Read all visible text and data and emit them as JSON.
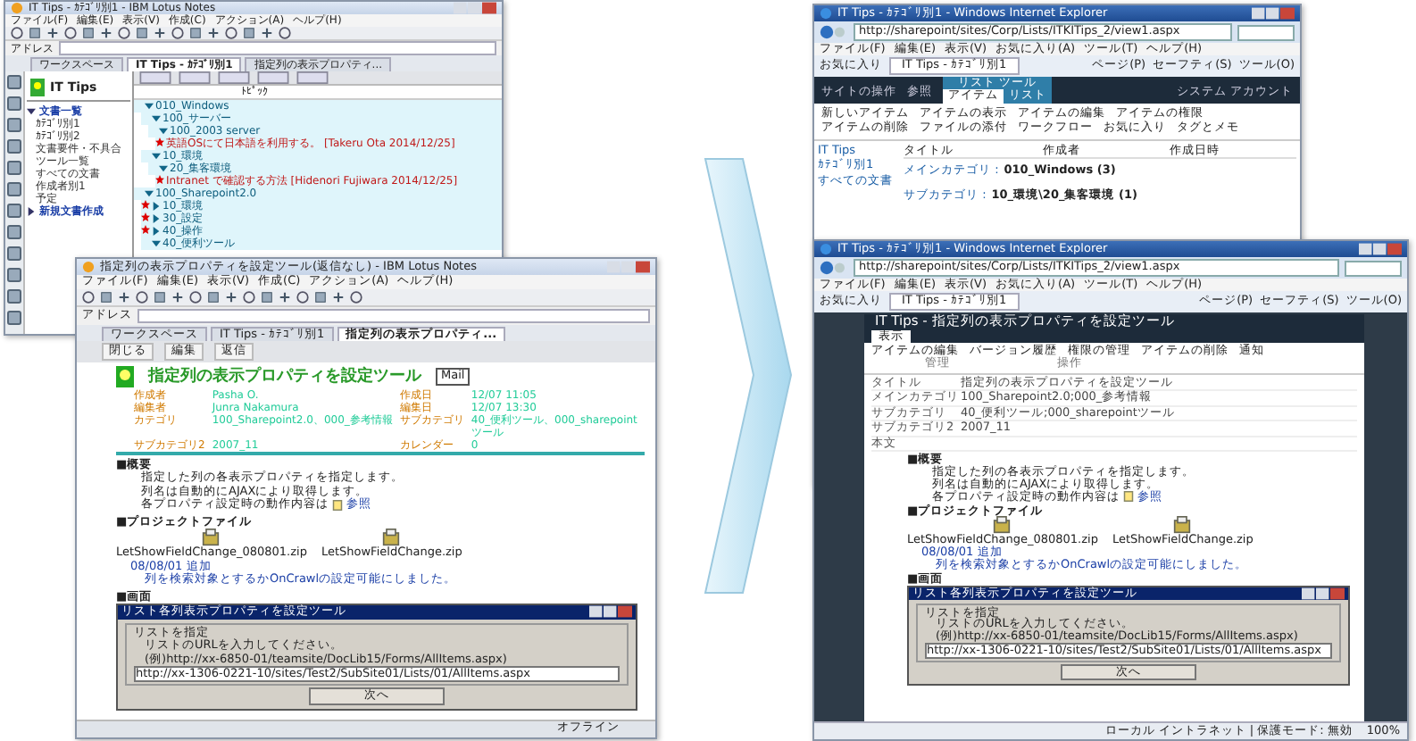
{
  "notes_back": {
    "title": "IT Tips - ｶﾃｺﾞﾘ別1 - IBM Lotus Notes",
    "menu": [
      "ファイル(F)",
      "編集(E)",
      "表示(V)",
      "作成(C)",
      "アクション(A)",
      "ヘルプ(H)"
    ],
    "address_label": "アドレス",
    "tabs": [
      {
        "label": "ワークスペース",
        "selected": false
      },
      {
        "label": "IT Tips - ｶﾃｺﾞﾘ別1",
        "selected": true
      },
      {
        "label": "指定列の表示プロパティ...",
        "selected": false
      }
    ],
    "db_title": "IT Tips",
    "nav": [
      {
        "label": "文書一覧",
        "expanded": true,
        "children": [
          "ｶﾃｺﾞﾘ別1",
          "ｶﾃｺﾞﾘ別2",
          "文書要件・不具合",
          "ツール一覧",
          "すべての文書",
          "作成者別1",
          "予定"
        ]
      },
      {
        "label": "新規文書作成",
        "expanded": false
      }
    ],
    "column_header": "ﾄﾋﾟｯｸ",
    "rows": [
      {
        "kind": "category",
        "text": "010_Windows",
        "expanded": true,
        "unread": false,
        "children": [
          {
            "kind": "category",
            "text": "100_サーバー",
            "expanded": true,
            "unread": false,
            "children": [
              {
                "kind": "category",
                "text": "100_2003 server",
                "expanded": true,
                "unread": false,
                "children": [
                  {
                    "kind": "document",
                    "text": "英語OSにて日本語を利用する。 [Takeru Ota 2014/12/25]",
                    "unread": true,
                    "selected": false
                  }
                ]
              }
            ]
          },
          {
            "kind": "category",
            "text": "10_環境",
            "expanded": true,
            "unread": false,
            "children": [
              {
                "kind": "category",
                "text": "20_集客環境",
                "expanded": true,
                "unread": false,
                "children": [
                  {
                    "kind": "document",
                    "text": "Intranet で確認する方法 [Hidenori Fujiwara 2014/12/25]",
                    "unread": true,
                    "selected": false
                  }
                ]
              }
            ]
          }
        ]
      },
      {
        "kind": "category",
        "text": "100_Sharepoint2.0",
        "expanded": true,
        "unread": false,
        "children": [
          {
            "kind": "category",
            "text": "10_環境",
            "expanded": false,
            "unread": true
          },
          {
            "kind": "category",
            "text": "30_設定",
            "expanded": false,
            "unread": true
          },
          {
            "kind": "category",
            "text": "40_操作",
            "expanded": false,
            "unread": true
          },
          {
            "kind": "category",
            "text": "40_便利ツール",
            "expanded": true,
            "unread": false
          }
        ]
      }
    ]
  },
  "notes_front": {
    "title": "指定列の表示プロパティを設定ツール(返信なし) - IBM Lotus Notes",
    "menu": [
      "ファイル(F)",
      "編集(E)",
      "表示(V)",
      "作成(C)",
      "アクション(A)",
      "ヘルプ(H)"
    ],
    "address_label": "アドレス",
    "tabs": [
      {
        "label": "ワークスペース",
        "selected": false
      },
      {
        "label": "IT Tips - ｶﾃｺﾞﾘ別1",
        "selected": false
      },
      {
        "label": "指定列の表示プロパティ...",
        "selected": true
      }
    ],
    "actions": [
      "閉じる",
      "編集",
      "返信"
    ],
    "heading": "指定列の表示プロパティを設定ツール",
    "mail_button": "Mail",
    "meta": [
      {
        "label": "作成者",
        "value": "Pasha O."
      },
      {
        "label": "作成日",
        "value": "12/07 11:05"
      },
      {
        "label": "編集者",
        "value": "Junra Nakamura"
      },
      {
        "label": "編集日",
        "value": "12/07 13:30"
      },
      {
        "label": "カテゴリ",
        "value": "100_Sharepoint2.0、000_参考情報"
      },
      {
        "label": "サブカテゴリ",
        "value": "40_便利ツール、000_sharepointツール"
      },
      {
        "label": "サブカテゴリ2",
        "value": "2007_11"
      },
      {
        "label": "カレンダー",
        "value": "0"
      }
    ],
    "doc": {
      "overview_heading": "■概要",
      "overview": [
        "指定した列の各表示プロパティを指定します。",
        "列名は自動的にAJAXにより取得します。"
      ],
      "reference": "各プロパティ設定時の動作内容は",
      "reference_link": "参照",
      "files_heading": "■プロジェクトファイル",
      "files": [
        "LetShowFieldChange_080801.zip",
        "LetShowFieldChange.zip"
      ],
      "note_date": "08/08/01 追加",
      "note": "列を検索対象とするかOnCrawlの設定可能にしました。",
      "screen_heading": "■画面",
      "dialog": {
        "title": "リスト各列表示プロパティを設定ツール",
        "group": "リストを指定",
        "prompt": "リストのURLを入力してください。",
        "example": "(例)http://xx-6850-01/teamsite/DocLib15/Forms/AllItems.aspx)",
        "value": "http://xx-1306-0221-10/sites/Test2/SubSite01/Lists/01/AllItems.aspx",
        "button": "次へ"
      }
    },
    "status": "オフライン"
  },
  "ie_back": {
    "title": "IT Tips - ｶﾃｺﾞﾘ別1 - Windows Internet Explorer",
    "url": "http://sharepoint/sites/Corp/Lists/ITKITips_2/view1.aspx",
    "menu": [
      "ファイル(F)",
      "編集(E)",
      "表示(V)",
      "お気に入り(A)",
      "ツール(T)",
      "ヘルプ(H)"
    ],
    "favorites": "お気に入り",
    "tab": "IT Tips - ｶﾃｺﾞﾘ別1",
    "commands": [
      "ページ(P)",
      "セーフティ(S)",
      "ツール(O)"
    ],
    "site_actions": "サイトの操作",
    "browse": "参照",
    "tool_group": "リスト ツール",
    "ribbon_tabs": [
      {
        "label": "アイテム",
        "selected": true
      },
      {
        "label": "リスト",
        "selected": false
      }
    ],
    "account": "システム アカウント",
    "ribbon_buttons": [
      "新しいアイテム",
      "アイテムの表示",
      "アイテムの編集",
      "アイテムの権限",
      "アイテムの削除",
      "ファイルの添付",
      "ワークフロー",
      "お気に入り",
      "タグとメモ"
    ],
    "nav": [
      "IT Tips",
      "ｶﾃｺﾞﾘ別1",
      "すべての文書"
    ],
    "columns": [
      "タイトル",
      "作成者",
      "作成日時"
    ],
    "groups": [
      {
        "label": "メインカテゴリ :",
        "value": "010_Windows (3)"
      },
      {
        "label": "サブカテゴリ :",
        "value": "10_環境\\20_集客環境 (1)"
      }
    ]
  },
  "ie_front": {
    "title": "IT Tips - ｶﾃｺﾞﾘ別1 - Windows Internet Explorer",
    "url": "http://sharepoint/sites/Corp/Lists/ITKITips_2/view1.aspx",
    "menu": [
      "ファイル(F)",
      "編集(E)",
      "表示(V)",
      "お気に入り(A)",
      "ツール(T)",
      "ヘルプ(H)"
    ],
    "favorites": "お気に入り",
    "tab": "IT Tips - ｶﾃｺﾞﾘ別1",
    "commands": [
      "ページ(P)",
      "セーフティ(S)",
      "ツール(O)"
    ],
    "modal_title": "IT Tips - 指定列の表示プロパティを設定ツール",
    "modal_tab": "表示",
    "modal_buttons": [
      "アイテムの編集",
      "バージョン履歴",
      "権限の管理",
      "アイテムの削除",
      "通知"
    ],
    "modal_groups": [
      "管理",
      "操作"
    ],
    "fields": [
      {
        "label": "タイトル",
        "value": "指定列の表示プロパティを設定ツール"
      },
      {
        "label": "メインカテゴリ",
        "value": "100_Sharepoint2.0;000_参考情報"
      },
      {
        "label": "サブカテゴリ",
        "value": "40_便利ツール;000_sharepointツール"
      },
      {
        "label": "サブカテゴリ2",
        "value": "2007_11"
      },
      {
        "label": "本文"
      }
    ],
    "doc": {
      "overview_heading": "■概要",
      "overview": [
        "指定した列の各表示プロパティを指定します。",
        "列名は自動的にAJAXにより取得します。"
      ],
      "reference": "各プロパティ設定時の動作内容は",
      "reference_link": "参照",
      "files_heading": "■プロジェクトファイル",
      "files": [
        "LetShowFieldChange_080801.zip",
        "LetShowFieldChange.zip"
      ],
      "note_date": "08/08/01 追加",
      "note": "列を検索対象とするかOnCrawlの設定可能にしました。",
      "screen_heading": "■画面",
      "dialog": {
        "title": "リスト各列表示プロパティを設定ツール",
        "group": "リストを指定",
        "prompt": "リストのURLを入力してください。",
        "example": "(例)http://xx-6850-01/teamsite/DocLib15/Forms/AllItems.aspx)",
        "value": "http://xx-1306-0221-10/sites/Test2/SubSite01/Lists/01/AllItems.aspx",
        "button": "次へ"
      }
    },
    "zone": "ローカル イントラネット | 保護モード: 無効",
    "zoom": "100%"
  }
}
